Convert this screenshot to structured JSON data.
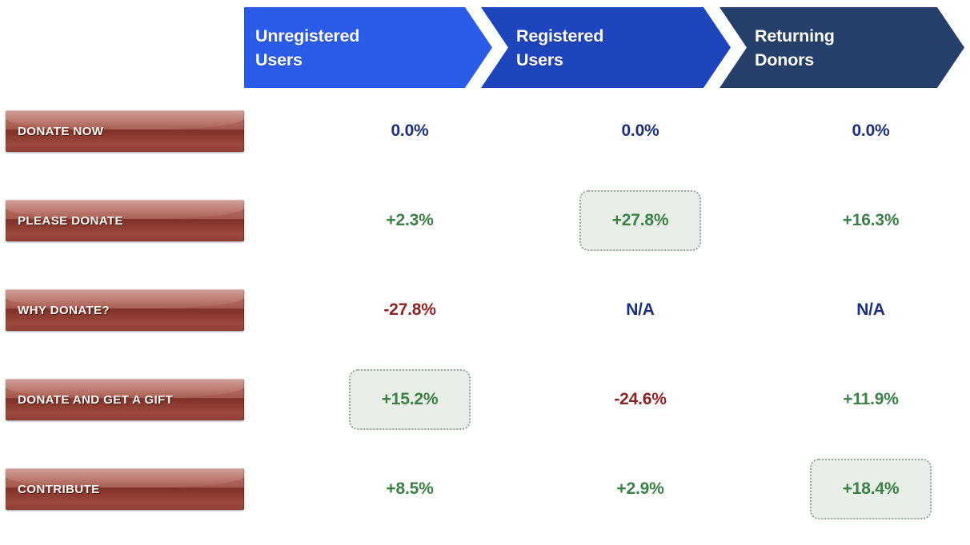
{
  "funnel": {
    "stages": [
      {
        "id": "unregistered-users",
        "line1": "Unregistered",
        "line2": "Users",
        "color": "#2B5CE8"
      },
      {
        "id": "registered-users",
        "line1": "Registered",
        "line2": "Users",
        "color": "#1F45BC"
      },
      {
        "id": "returning-donors",
        "line1": "Returning",
        "line2": "Donors",
        "color": "#26406B"
      }
    ]
  },
  "colors": {
    "positive": "#3C8048",
    "negative": "#8C2222",
    "neutral": "#1C2F7C",
    "highlight_fill": "#E9EEE9",
    "highlight_border": "#9AA49A",
    "button_red": "#8D3B31"
  },
  "rows": [
    {
      "id": "donate-now",
      "button_label": "DONATE NOW",
      "cells": [
        {
          "value": "0.0%",
          "tone": "neutral",
          "highlight": false
        },
        {
          "value": "0.0%",
          "tone": "neutral",
          "highlight": false
        },
        {
          "value": "0.0%",
          "tone": "neutral",
          "highlight": false
        }
      ]
    },
    {
      "id": "please-donate",
      "button_label": "PLEASE DONATE",
      "cells": [
        {
          "value": "+2.3%",
          "tone": "positive",
          "highlight": false
        },
        {
          "value": "+27.8%",
          "tone": "positive",
          "highlight": true
        },
        {
          "value": "+16.3%",
          "tone": "positive",
          "highlight": false
        }
      ]
    },
    {
      "id": "why-donate",
      "button_label": "WHY DONATE?",
      "cells": [
        {
          "value": "-27.8%",
          "tone": "negative",
          "highlight": false
        },
        {
          "value": "N/A",
          "tone": "neutral",
          "highlight": false
        },
        {
          "value": "N/A",
          "tone": "neutral",
          "highlight": false
        }
      ]
    },
    {
      "id": "donate-and-get-a-gift",
      "button_label": "DONATE AND GET A GIFT",
      "cells": [
        {
          "value": "+15.2%",
          "tone": "positive",
          "highlight": true
        },
        {
          "value": "-24.6%",
          "tone": "negative",
          "highlight": false
        },
        {
          "value": "+11.9%",
          "tone": "positive",
          "highlight": false
        }
      ]
    },
    {
      "id": "contribute",
      "button_label": "CONTRIBUTE",
      "cells": [
        {
          "value": "+8.5%",
          "tone": "positive",
          "highlight": false
        },
        {
          "value": "+2.9%",
          "tone": "positive",
          "highlight": false
        },
        {
          "value": "+18.4%",
          "tone": "positive",
          "highlight": true
        }
      ]
    }
  ],
  "chart_data": {
    "type": "table",
    "title": "",
    "categories": [
      "Unregistered Users",
      "Registered Users",
      "Returning Donors"
    ],
    "row_labels": [
      "DONATE NOW",
      "PLEASE DONATE",
      "WHY DONATE?",
      "DONATE AND GET A GIFT",
      "CONTRIBUTE"
    ],
    "series": [
      {
        "name": "DONATE NOW",
        "values": [
          0.0,
          0.0,
          0.0
        ]
      },
      {
        "name": "PLEASE DONATE",
        "values": [
          2.3,
          27.8,
          16.3
        ]
      },
      {
        "name": "WHY DONATE?",
        "values": [
          -27.8,
          null,
          null
        ]
      },
      {
        "name": "DONATE AND GET A GIFT",
        "values": [
          15.2,
          -24.6,
          11.9
        ]
      },
      {
        "name": "CONTRIBUTE",
        "values": [
          8.5,
          2.9,
          18.4
        ]
      }
    ],
    "display_values": [
      [
        "0.0%",
        "0.0%",
        "0.0%"
      ],
      [
        "+2.3%",
        "+27.8%",
        "+16.3%"
      ],
      [
        "-27.8%",
        "N/A",
        "N/A"
      ],
      [
        "+15.2%",
        "-24.6%",
        "+11.9%"
      ],
      [
        "+8.5%",
        "+2.9%",
        "+18.4%"
      ]
    ],
    "highlighted_cells": [
      [
        1,
        1
      ],
      [
        3,
        0
      ],
      [
        4,
        2
      ]
    ],
    "xlabel": "",
    "ylabel": "",
    "grid": false,
    "legend": "none"
  }
}
